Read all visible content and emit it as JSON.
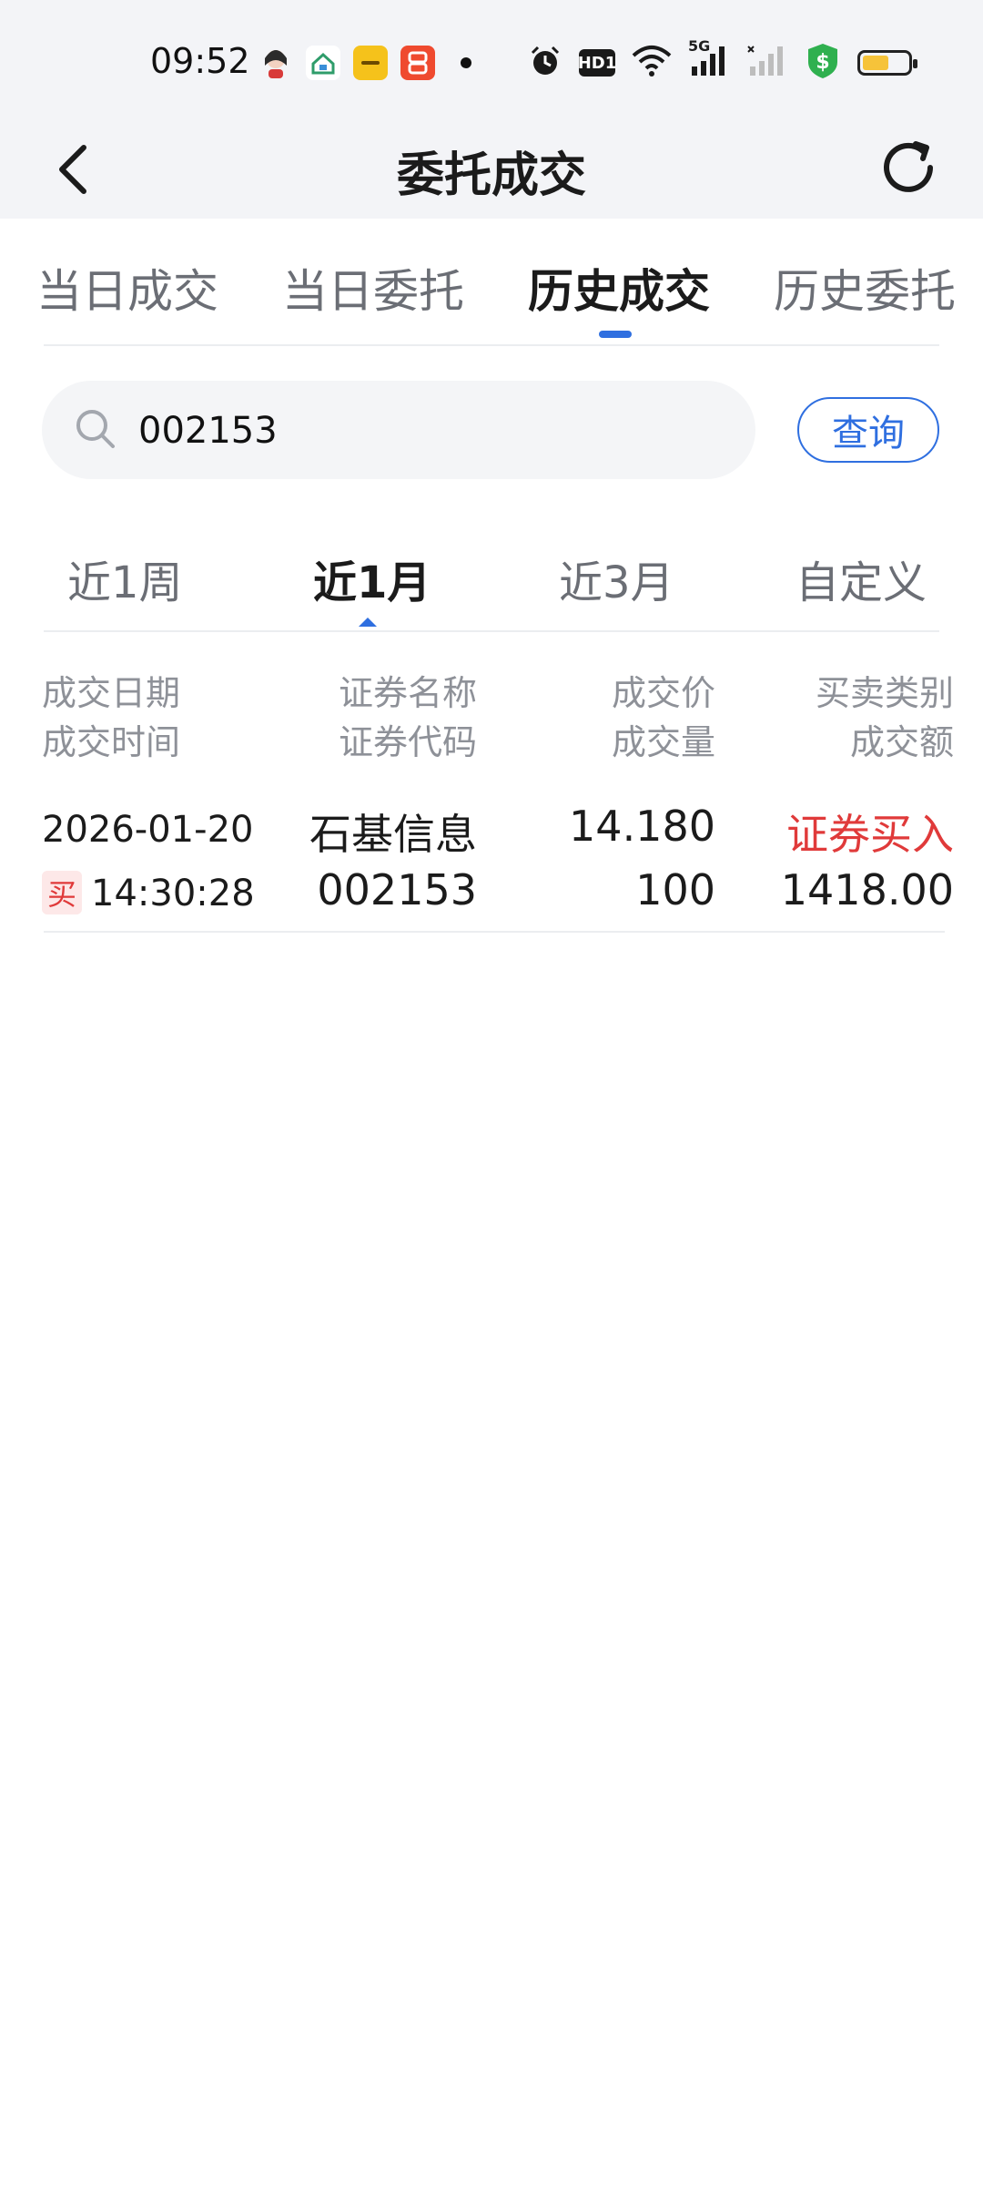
{
  "status_bar": {
    "time": "09:52",
    "icons": [
      "avatar-notification-icon",
      "smart-home-icon",
      "realme-icon",
      "app-store-icon",
      "alarm-icon",
      "hd-icon",
      "wifi-icon",
      "signal-5g-icon",
      "signal-icon",
      "shield-dollar-icon",
      "battery-icon"
    ],
    "hd_label": "HD1",
    "network_label": "5G"
  },
  "header": {
    "title": "委托成交"
  },
  "main_tabs": [
    {
      "label": "当日成交"
    },
    {
      "label": "当日委托"
    },
    {
      "label": "历史成交"
    },
    {
      "label": "历史委托"
    }
  ],
  "search": {
    "value": "002153",
    "button_label": "查询"
  },
  "period_tabs": [
    {
      "label": "近1周"
    },
    {
      "label": "近1月"
    },
    {
      "label": "近3月"
    },
    {
      "label": "自定义"
    }
  ],
  "columns": {
    "col1_line1": "成交日期",
    "col1_line2": "成交时间",
    "col2_line1": "证券名称",
    "col2_line2": "证券代码",
    "col3_line1": "成交价",
    "col3_line2": "成交量",
    "col4_line1": "买卖类别",
    "col4_line2": "成交额"
  },
  "rows": [
    {
      "date": "2026-01-20",
      "time": "14:30:28",
      "tag": "买",
      "name": "石基信息",
      "code": "002153",
      "price": "14.180",
      "volume": "100",
      "type": "证券买入",
      "amount": "1418.00"
    }
  ],
  "colors": {
    "accent": "#2f6fe0",
    "buy_red": "#e03a3a"
  }
}
